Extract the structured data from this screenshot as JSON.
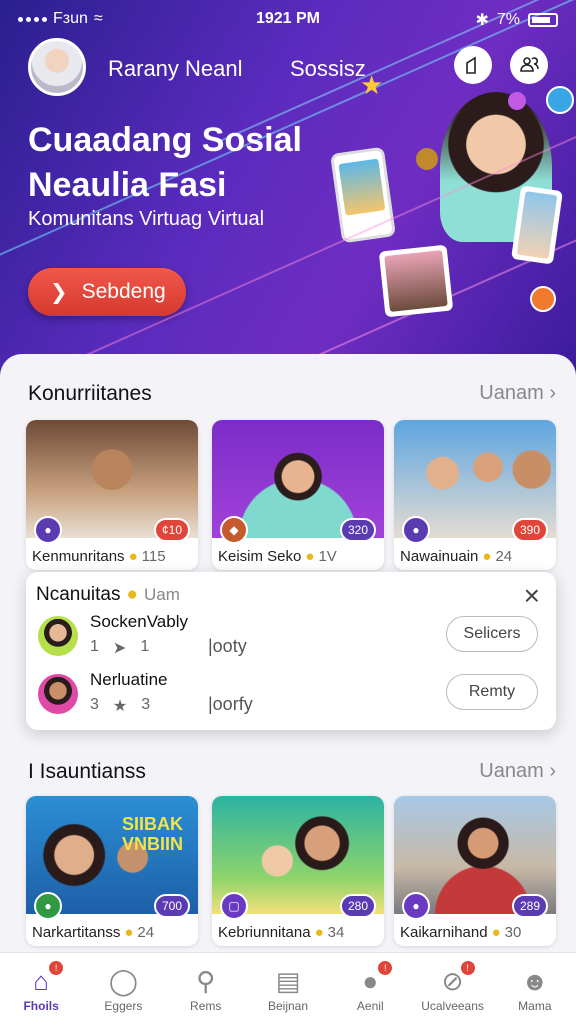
{
  "status_bar": {
    "carrier": "Fзun",
    "time": "1921 PM",
    "battery": "7%"
  },
  "header": {
    "user_name": "Rarany Neanl",
    "link": "Sossisz",
    "title": "Cuaadang Sosial Neaulia Fasi",
    "subtitle": "Komunitans Virtuag Virtual",
    "cta_label": "Sebdeng",
    "icons": [
      "home-icon",
      "group-icon"
    ]
  },
  "communities": {
    "title": "Konurriitanes",
    "more": "Uanam",
    "cards": [
      {
        "label": "Kenmunritans",
        "count": "115",
        "badge": "¢10"
      },
      {
        "label": "Keisim Seko",
        "count": "1V",
        "badge": "320"
      },
      {
        "label": "Nawainuain",
        "count": "24",
        "badge": "390"
      }
    ]
  },
  "popup": {
    "title": "Ncanuitas",
    "subtitle": "Uam",
    "users": [
      {
        "name": "SockenVably",
        "count_a": "1",
        "count_b": "1",
        "tag": "|ooty",
        "button": "Selicers"
      },
      {
        "name": "Nerluatine",
        "count_a": "3",
        "count_b": "3",
        "tag": "|oorfy",
        "button": "Remty"
      }
    ]
  },
  "second_section": {
    "title": "I Isauntianss",
    "more": "Uanam",
    "poster_text": [
      "SIIBAK",
      "VNBIIN"
    ],
    "cards": [
      {
        "label": "Narkartitanss",
        "count": "24",
        "badge": "700"
      },
      {
        "label": "Kebriunnitana",
        "count": "34",
        "badge": "280"
      },
      {
        "label": "Kaikarnihand",
        "count": "30",
        "badge": "289"
      }
    ]
  },
  "tabs": [
    {
      "label": "Fhoils",
      "icon": "home-icon",
      "active": true,
      "dot": true
    },
    {
      "label": "Eggers",
      "icon": "chat-icon",
      "active": false,
      "dot": false
    },
    {
      "label": "Rems",
      "icon": "search-icon",
      "active": false,
      "dot": false
    },
    {
      "label": "Beijnan",
      "icon": "document-icon",
      "active": false,
      "dot": false
    },
    {
      "label": "Aenil",
      "icon": "message-icon",
      "active": false,
      "dot": true
    },
    {
      "label": "Ucalveeans",
      "icon": "compass-icon",
      "active": false,
      "dot": true
    },
    {
      "label": "Mama",
      "icon": "profile-icon",
      "active": false,
      "dot": false
    }
  ],
  "colors": {
    "accent": "#5b3bb2",
    "cta": "#e0453a",
    "hero_gradient": [
      "#2a1f8f",
      "#6f2dc2"
    ]
  }
}
